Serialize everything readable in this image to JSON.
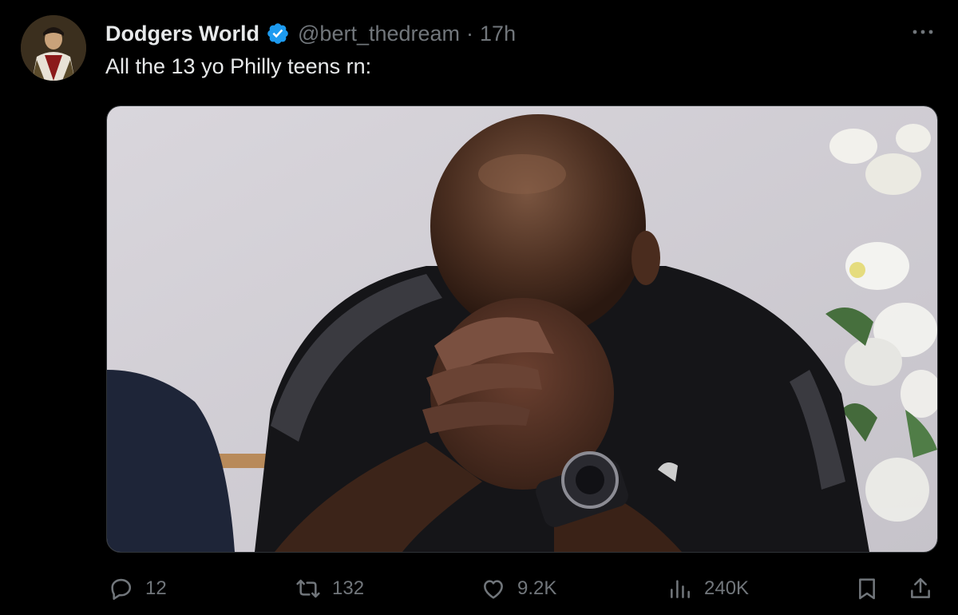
{
  "tweet": {
    "display_name": "Dodgers World",
    "handle": "@bert_thedream",
    "separator": "·",
    "time": "17h",
    "text": "All the 13 yo Philly teens rn:"
  },
  "actions": {
    "replies": "12",
    "reposts": "132",
    "likes": "9.2K",
    "views": "240K"
  },
  "icons": {
    "verified": "verified-badge-icon",
    "more": "more-options-icon",
    "reply": "reply-icon",
    "repost": "repost-icon",
    "like": "heart-icon",
    "views": "views-chart-icon",
    "bookmark": "bookmark-icon",
    "share": "share-icon"
  },
  "colors": {
    "background": "#000000",
    "text_primary": "#e7e9ea",
    "text_secondary": "#71767b",
    "verified_blue": "#1d9bf0"
  }
}
